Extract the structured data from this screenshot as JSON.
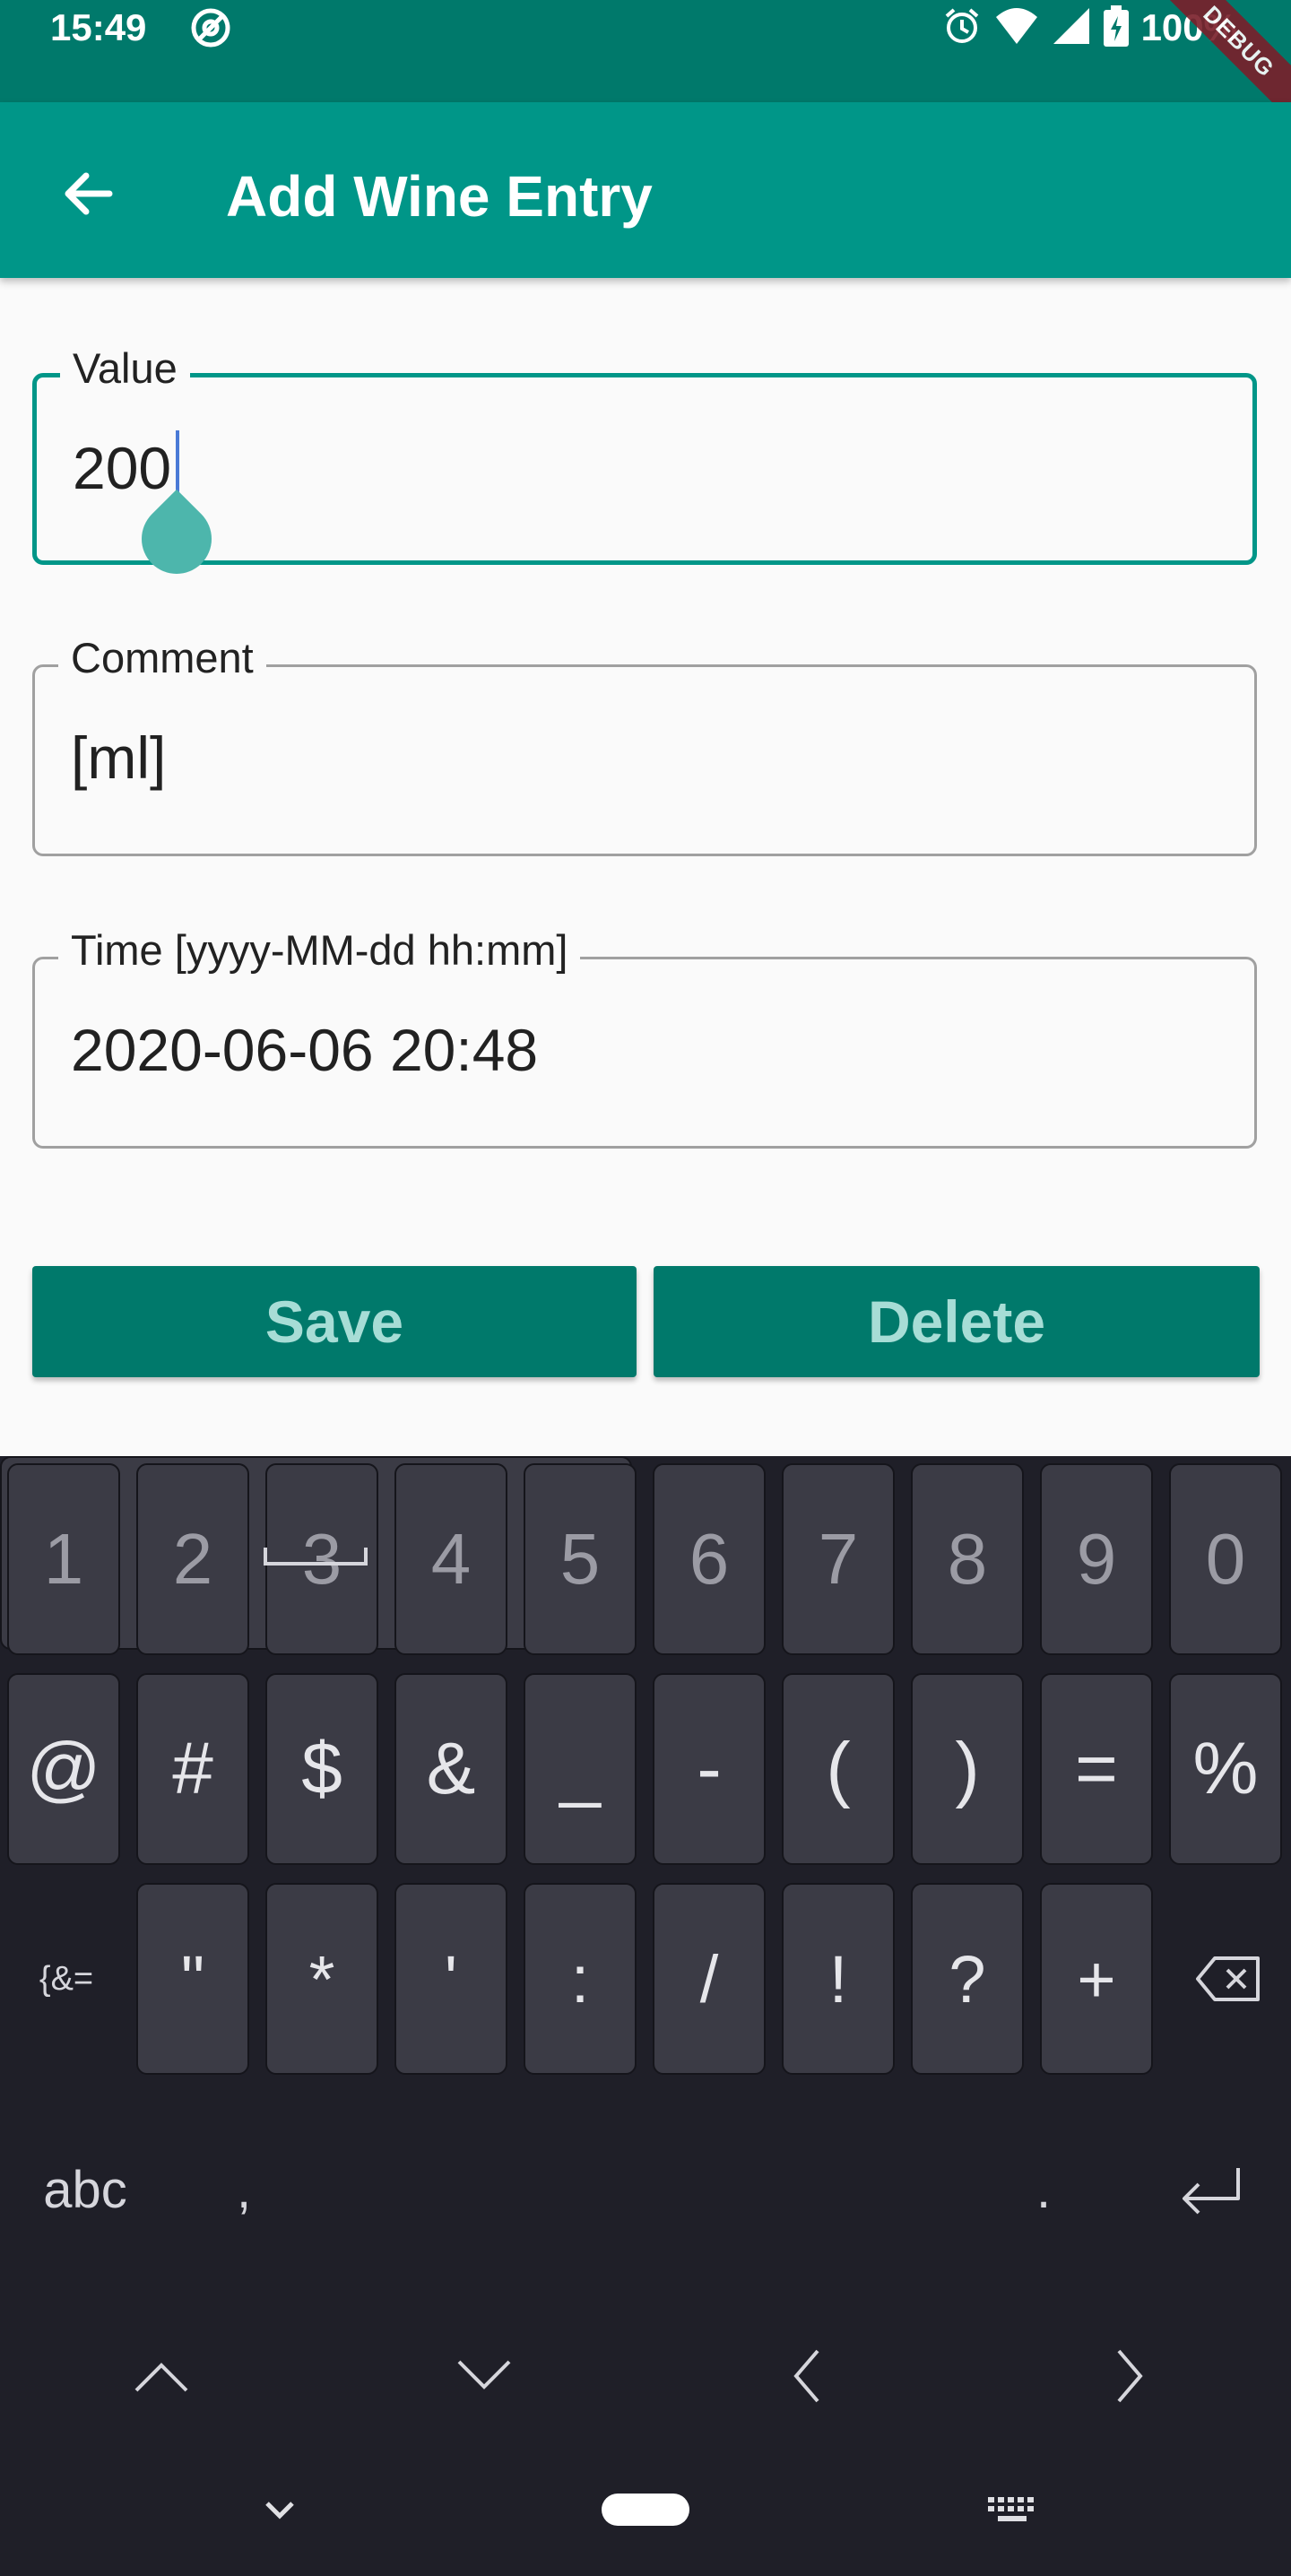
{
  "status_bar": {
    "time": "15:49",
    "battery": "100%",
    "debug_banner": "DEBUG"
  },
  "app_bar": {
    "title": "Add Wine Entry"
  },
  "form": {
    "value_label": "Value",
    "value": "200",
    "comment_label": "Comment",
    "comment": "[ml]",
    "time_label": "Time [yyyy-MM-dd hh:mm]",
    "time": "2020-06-06 20:48"
  },
  "buttons": {
    "save": "Save",
    "delete": "Delete"
  },
  "keyboard": {
    "row1": [
      "1",
      "2",
      "3",
      "4",
      "5",
      "6",
      "7",
      "8",
      "9",
      "0"
    ],
    "row2": [
      "@",
      "#",
      "$",
      "&",
      "_",
      "-",
      "(",
      ")",
      "=",
      "%"
    ],
    "row3_lead": "{&=",
    "row3": [
      "\"",
      "*",
      "'",
      ":",
      "/",
      "!",
      "?",
      "+"
    ],
    "abc": "abc",
    "comma": ",",
    "period": "."
  },
  "colors": {
    "status_bar": "#00796b",
    "app_bar": "#009688",
    "button": "#00796b",
    "keyboard_bg": "#1f1f28",
    "key_bg": "#3b3b45"
  }
}
